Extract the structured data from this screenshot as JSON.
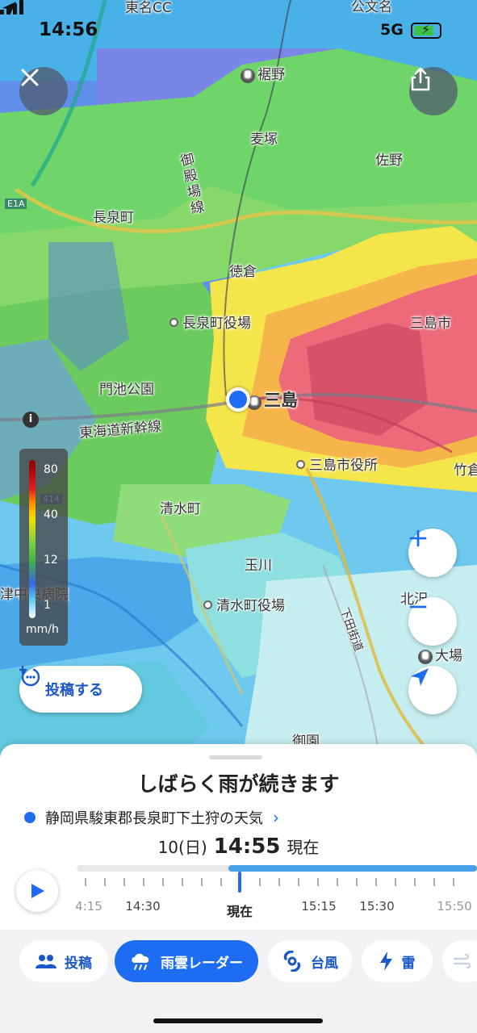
{
  "status_bar": {
    "time": "14:56",
    "network": "5G"
  },
  "map": {
    "labels": {
      "tomeicc": "東名CC",
      "kokubun": "公文名",
      "susono": "裾野",
      "mugitsuka": "麦塚",
      "sano": "佐野",
      "gotemba_line": "御殿場線",
      "e1a": "E1A",
      "nagaizumi": "長泉町",
      "tokura": "徳倉",
      "nagaizumi_office": "長泉町役場",
      "mishima_city": "三島市",
      "monike": "門池公園",
      "mishima_station": "三島",
      "tokaido": "東海道新幹線",
      "mishima_office": "三島市役所",
      "takekura": "竹倉",
      "route414": "414",
      "shimizu": "清水町",
      "tamagawa": "玉川",
      "hospital": "津中央病院",
      "shimizu_office": "清水町役場",
      "kitazawa": "北沢",
      "shimoda_kaido": "下田街道",
      "oba": "大場",
      "goen": "御園"
    }
  },
  "legend": {
    "values": [
      "80",
      "40",
      "12",
      "1"
    ],
    "unit": "mm/h"
  },
  "post_button": {
    "label": "投稿する"
  },
  "sheet": {
    "headline": "しばらく雨が続きます",
    "place": "静岡県駿東郡長泉町下土狩の天気",
    "date": "10(日)",
    "time": "14:55",
    "time_suffix": "現在",
    "ticks": [
      "4:15",
      "14:30",
      "現在",
      "15:15",
      "15:30",
      "15:50"
    ]
  },
  "tabs": [
    {
      "label": "投稿",
      "icon": "people-icon"
    },
    {
      "label": "雨雲レーダー",
      "icon": "rain-cloud-icon"
    },
    {
      "label": "台風",
      "icon": "typhoon-icon"
    },
    {
      "label": "雷",
      "icon": "lightning-icon"
    }
  ],
  "colors": {
    "accent": "#1e6cf2",
    "accent_text": "#1a57c8"
  }
}
